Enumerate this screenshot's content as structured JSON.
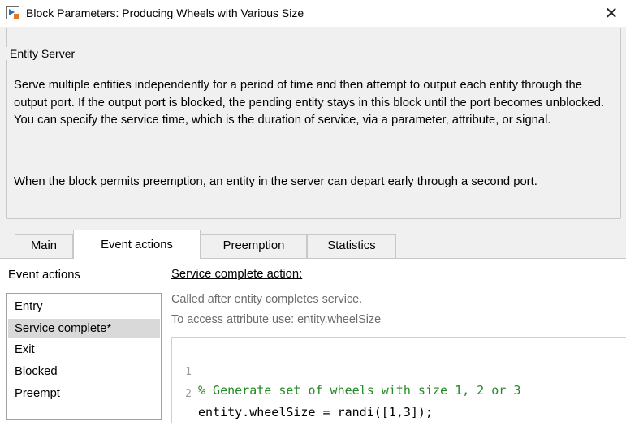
{
  "window": {
    "title": "Block Parameters: Producing Wheels with Various Size",
    "close_glyph": "✕"
  },
  "block": {
    "group_title": "Entity Server",
    "description_1": "Serve multiple entities independently for a period of time and then attempt to output each entity through the output port. If the output port is blocked, the pending entity stays in this block until the port becomes unblocked. You can specify the service time, which is the duration of service, via a parameter, attribute, or signal.",
    "description_2": "When the block permits preemption, an entity in the server can depart early through a second port."
  },
  "tabs": [
    {
      "label": "Main"
    },
    {
      "label": "Event actions"
    },
    {
      "label": "Preemption"
    },
    {
      "label": "Statistics"
    }
  ],
  "event_actions": {
    "label": "Event actions",
    "items": [
      {
        "label": "Entry"
      },
      {
        "label": "Service complete*"
      },
      {
        "label": "Exit"
      },
      {
        "label": "Blocked"
      },
      {
        "label": "Preempt"
      }
    ]
  },
  "action_panel": {
    "title": "Service complete action:",
    "hint_1": "Called after entity completes service.",
    "hint_2": "To access attribute use: entity.wheelSize"
  },
  "editor": {
    "lines": [
      {
        "number": "1",
        "text": "% Generate set of wheels with size 1, 2 or 3"
      },
      {
        "number": "2",
        "text": "entity.wheelSize = randi([1,3]);"
      }
    ]
  },
  "colors": {
    "comment": "#228b22",
    "selected_row": "#d9d9d9",
    "panel_bg": "#f0f0f0"
  }
}
